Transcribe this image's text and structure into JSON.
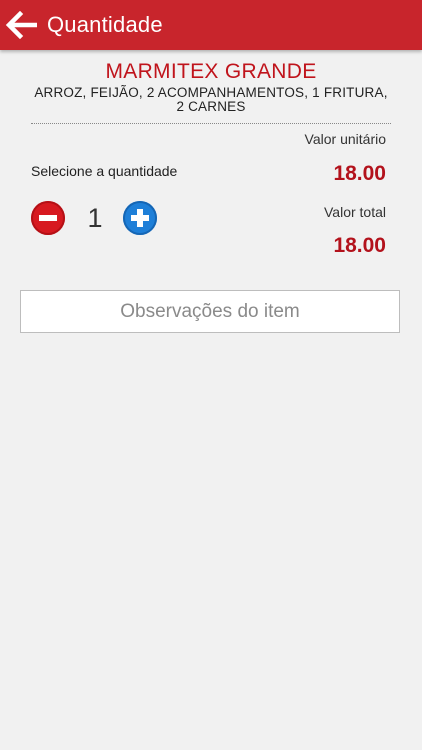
{
  "header": {
    "title": "Quantidade",
    "back_icon": "arrow-left-icon",
    "background": "#c8252c"
  },
  "product": {
    "name": "MARMITEX GRANDE",
    "description": "ARROZ, FEIJÃO, 2 ACOMPANHAMENTOS, 1 FRITURA, 2 CARNES"
  },
  "pricing": {
    "unit_label": "Valor unitário",
    "unit_price": "18.00",
    "total_label": "Valor total",
    "total_price": "18.00",
    "price_color": "#b3121c"
  },
  "quantity": {
    "label": "Selecione a quantidade",
    "value": "1",
    "minus_icon": "minus-circle-icon",
    "plus_icon": "plus-circle-icon"
  },
  "notes": {
    "placeholder": "Observações do item"
  }
}
